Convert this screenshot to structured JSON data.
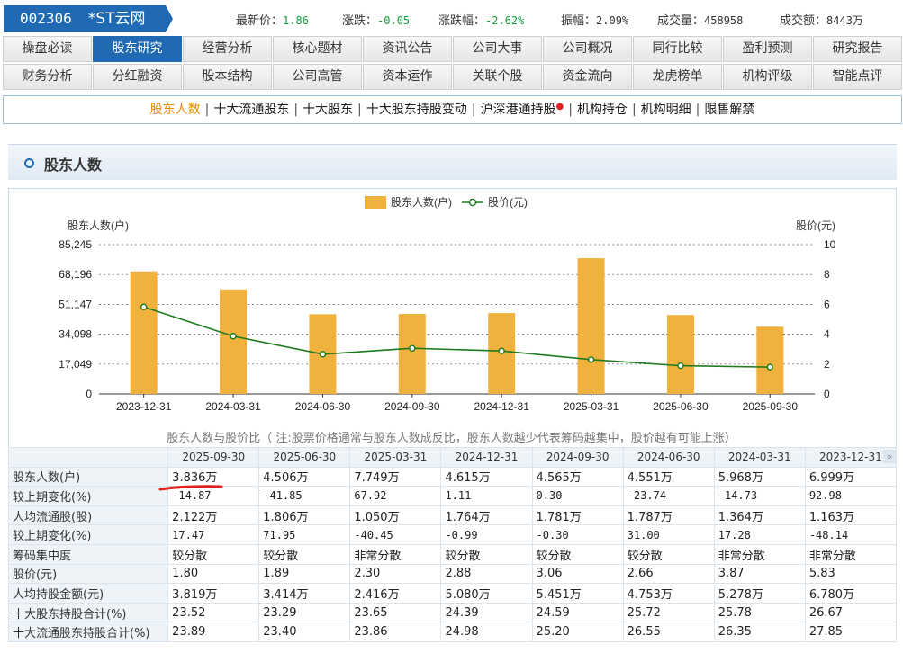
{
  "header": {
    "code": "002306",
    "name": "*ST云网",
    "quotes": [
      {
        "label": "最新价：",
        "value": "1.86",
        "color": "green"
      },
      {
        "label": "涨跌：",
        "value": "-0.05",
        "color": "green"
      },
      {
        "label": "涨跌幅：",
        "value": "-2.62%",
        "color": "green"
      },
      {
        "label": "振幅：",
        "value": "2.09%",
        "color": "normal"
      },
      {
        "label": "成交量：",
        "value": "458958",
        "color": "normal"
      },
      {
        "label": "成交额：",
        "value": "8443万",
        "color": "normal"
      }
    ]
  },
  "tabs": {
    "row1": [
      "操盘必读",
      "股东研究",
      "经营分析",
      "核心题材",
      "资讯公告",
      "公司大事",
      "公司概况",
      "同行比较",
      "盈利预测",
      "研究报告"
    ],
    "row2": [
      "财务分析",
      "分红融资",
      "股本结构",
      "公司高管",
      "资本运作",
      "关联个股",
      "资金流向",
      "龙虎榜单",
      "机构评级",
      "智能点评"
    ],
    "active": "股东研究"
  },
  "subnav": {
    "items": [
      "股东人数",
      "十大流通股东",
      "十大股东",
      "十大股东持股变动",
      "沪深港通持股",
      "机构持仓",
      "机构明细",
      "限售解禁"
    ],
    "active": "股东人数",
    "dot_after": "沪深港通持股"
  },
  "section": {
    "title": "股东人数"
  },
  "chart_data": {
    "type": "bar",
    "categories": [
      "2023-12-31",
      "2024-03-31",
      "2024-06-30",
      "2024-09-30",
      "2024-12-31",
      "2025-03-31",
      "2025-06-30",
      "2025-09-30"
    ],
    "series": [
      {
        "name": "股东人数(户)",
        "type": "bar",
        "axis": "left",
        "color": "#f0b13d",
        "values": [
          69990,
          59680,
          45510,
          45650,
          46150,
          77490,
          45060,
          38360
        ]
      },
      {
        "name": "股价(元)",
        "type": "line",
        "axis": "right",
        "color": "#1e7a1e",
        "values": [
          5.83,
          3.87,
          2.66,
          3.06,
          2.88,
          2.3,
          1.89,
          1.8
        ]
      }
    ],
    "ylabel": "股东人数(户)",
    "y2label": "股价(元)",
    "ylim": [
      0,
      85245
    ],
    "yticks": [
      "0",
      "17,049",
      "34,098",
      "51,147",
      "68,196",
      "85,245"
    ],
    "y2lim": [
      0,
      10
    ],
    "y2ticks": [
      "0",
      "2",
      "4",
      "6",
      "8",
      "10"
    ],
    "legend": "top-center",
    "grid": "dashed horizontal"
  },
  "caption": "股东人数与股价比（ 注:股票价格通常与股东人数成反比，股东人数越少代表筹码越集中，股价越有可能上涨）",
  "table": {
    "dates": [
      "2025-09-30",
      "2025-06-30",
      "2025-03-31",
      "2024-12-31",
      "2024-09-30",
      "2024-06-30",
      "2024-03-31",
      "2023-12-31"
    ],
    "rows": [
      {
        "label": "股东人数(户)",
        "values": [
          "3.836万",
          "4.506万",
          "7.749万",
          "4.615万",
          "4.565万",
          "4.551万",
          "5.968万",
          "6.999万"
        ],
        "colors": [
          "n",
          "n",
          "n",
          "n",
          "n",
          "n",
          "n",
          "n"
        ]
      },
      {
        "label": "较上期变化(%)",
        "values": [
          "-14.87",
          "-41.85",
          "67.92",
          "1.11",
          "0.30",
          "-23.74",
          "-14.73",
          "92.98"
        ],
        "colors": [
          "g",
          "g",
          "r",
          "r",
          "r",
          "g",
          "g",
          "r"
        ]
      },
      {
        "label": "人均流通股(股)",
        "values": [
          "2.122万",
          "1.806万",
          "1.050万",
          "1.764万",
          "1.781万",
          "1.787万",
          "1.364万",
          "1.163万"
        ],
        "colors": [
          "n",
          "n",
          "n",
          "n",
          "n",
          "n",
          "n",
          "n"
        ]
      },
      {
        "label": "较上期变化(%)",
        "values": [
          "17.47",
          "71.95",
          "-40.45",
          "-0.99",
          "-0.30",
          "31.00",
          "17.28",
          "-48.14"
        ],
        "colors": [
          "r",
          "r",
          "g",
          "g",
          "g",
          "r",
          "r",
          "g"
        ]
      },
      {
        "label": "筹码集中度",
        "values": [
          "较分散",
          "较分散",
          "非常分散",
          "较分散",
          "较分散",
          "较分散",
          "非常分散",
          "非常分散"
        ],
        "colors": [
          "n",
          "n",
          "n",
          "n",
          "n",
          "n",
          "n",
          "n"
        ]
      },
      {
        "label": "股价(元)",
        "values": [
          "1.80",
          "1.89",
          "2.30",
          "2.88",
          "3.06",
          "2.66",
          "3.87",
          "5.83"
        ],
        "colors": [
          "n",
          "n",
          "n",
          "n",
          "n",
          "n",
          "n",
          "n"
        ]
      },
      {
        "label": "人均持股金额(元)",
        "values": [
          "3.819万",
          "3.414万",
          "2.416万",
          "5.080万",
          "5.451万",
          "4.753万",
          "5.278万",
          "6.780万"
        ],
        "colors": [
          "n",
          "n",
          "n",
          "n",
          "n",
          "n",
          "n",
          "n"
        ]
      },
      {
        "label": "十大股东持股合计(%)",
        "values": [
          "23.52",
          "23.29",
          "23.65",
          "24.39",
          "24.59",
          "25.72",
          "25.78",
          "26.67"
        ],
        "colors": [
          "n",
          "n",
          "n",
          "n",
          "n",
          "n",
          "n",
          "n"
        ]
      },
      {
        "label": "十大流通股东持股合计(%)",
        "values": [
          "23.89",
          "23.40",
          "23.86",
          "24.98",
          "25.20",
          "26.55",
          "26.35",
          "27.85"
        ],
        "colors": [
          "n",
          "n",
          "n",
          "n",
          "n",
          "n",
          "n",
          "n"
        ]
      }
    ]
  }
}
